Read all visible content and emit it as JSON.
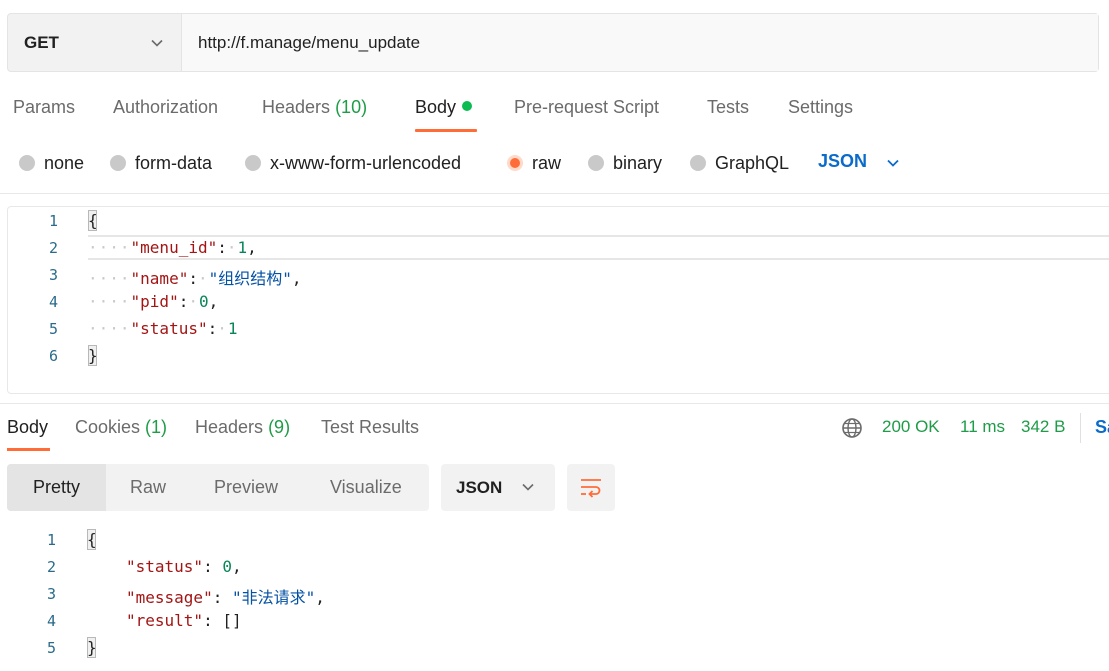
{
  "request": {
    "method": "GET",
    "url": "http://f.manage/menu_update"
  },
  "request_tabs": [
    {
      "label": "Params"
    },
    {
      "label": "Authorization"
    },
    {
      "label": "Headers",
      "count": "(10)"
    },
    {
      "label": "Body",
      "active": true
    },
    {
      "label": "Pre-request Script"
    },
    {
      "label": "Tests"
    },
    {
      "label": "Settings"
    }
  ],
  "body_types": {
    "none": "none",
    "form_data": "form-data",
    "urlencoded": "x-www-form-urlencoded",
    "raw": "raw",
    "binary": "binary",
    "graphql": "GraphQL",
    "selected": "raw",
    "language": "JSON"
  },
  "request_body_lines": {
    "n1": "1",
    "n2": "2",
    "n3": "3",
    "n4": "4",
    "n5": "5",
    "n6": "6",
    "open": "{",
    "k1": "\"menu_id\"",
    "v1": "1",
    "k2": "\"name\"",
    "v2": "\"组织结构\"",
    "k3": "\"pid\"",
    "v3": "0",
    "k4": "\"status\"",
    "v4": "1",
    "close": "}"
  },
  "response_tabs": [
    {
      "label": "Body",
      "active": true
    },
    {
      "label": "Cookies",
      "count": "(1)"
    },
    {
      "label": "Headers",
      "count": "(9)"
    },
    {
      "label": "Test Results"
    }
  ],
  "response_meta": {
    "status": "200 OK",
    "time": "11 ms",
    "size": "342 B",
    "save": "Sa"
  },
  "view_modes": {
    "pretty": "Pretty",
    "raw": "Raw",
    "preview": "Preview",
    "visualize": "Visualize",
    "format": "JSON"
  },
  "response_body_lines": {
    "n1": "1",
    "n2": "2",
    "n3": "3",
    "n4": "4",
    "n5": "5",
    "open": "{",
    "k1": "\"status\"",
    "v1": "0",
    "k2": "\"message\"",
    "v2": "\"非法请求\"",
    "k3": "\"result\"",
    "v3": "[]",
    "close": "}"
  },
  "colors": {
    "accent": "#ff6c37",
    "success": "#1e9c47",
    "link": "#0b6bcb"
  }
}
